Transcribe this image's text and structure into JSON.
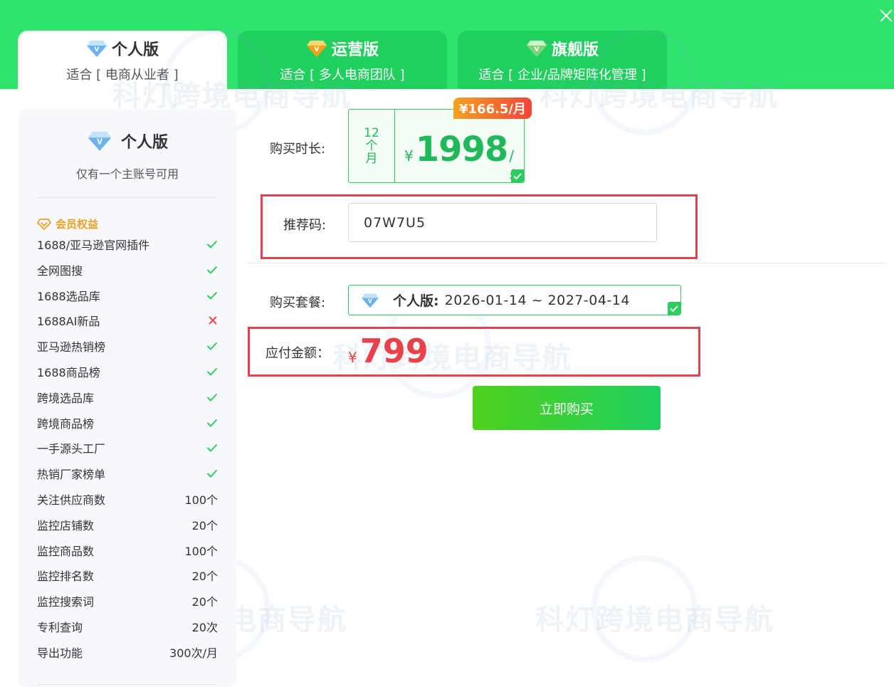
{
  "colors": {
    "header_green": "#2ee46c",
    "accent_green": "#1fb95a",
    "price_red": "#e8414a",
    "badge_orange": "#f7a01e",
    "benefits_orange": "#f0a020",
    "highlight_red": "#e2404c"
  },
  "watermark_text": "科灯跨境电商导航",
  "tabs": [
    {
      "title": "个人版",
      "subtitle": "适合 [ 电商从业者 ]",
      "icon": "diamond-blue-icon",
      "active": true
    },
    {
      "title": "运营版",
      "subtitle": "适合 [ 多人电商团队 ]",
      "icon": "diamond-gold-icon",
      "active": false
    },
    {
      "title": "旗舰版",
      "subtitle": "适合 [ 企业/品牌矩阵化管理 ]",
      "icon": "diamond-green-icon",
      "active": false
    }
  ],
  "left_panel": {
    "title": "个人版",
    "subtitle": "仅有一个主账号可用",
    "benefits_heading": "会员权益",
    "benefits": [
      {
        "label": "1688/亚马逊官网插件",
        "status": "check"
      },
      {
        "label": "全网图搜",
        "status": "check"
      },
      {
        "label": "1688选品库",
        "status": "check"
      },
      {
        "label": "1688AI新品",
        "status": "cross"
      },
      {
        "label": "亚马逊热销榜",
        "status": "check"
      },
      {
        "label": "1688商品榜",
        "status": "check"
      },
      {
        "label": "跨境选品库",
        "status": "check"
      },
      {
        "label": "跨境商品榜",
        "status": "check"
      },
      {
        "label": "一手源头工厂",
        "status": "check"
      },
      {
        "label": "热销厂家榜单",
        "status": "check"
      },
      {
        "label": "关注供应商数",
        "value": "100个"
      },
      {
        "label": "监控店铺数",
        "value": "20个"
      },
      {
        "label": "监控商品数",
        "value": "100个"
      },
      {
        "label": "监控排名数",
        "value": "20个"
      },
      {
        "label": "监控搜索词",
        "value": "20个"
      },
      {
        "label": "专利查询",
        "value": "20次"
      },
      {
        "label": "导出功能",
        "value": "300次/月"
      }
    ]
  },
  "form": {
    "duration_label": "购买时长:",
    "duration_option": {
      "months_chars": [
        "12",
        "个",
        "月"
      ],
      "currency": "¥",
      "price": "1998",
      "unit": "/年",
      "monthly_badge": "¥166.5/月",
      "selected": true
    },
    "referral_label": "推荐码:",
    "referral_value": "07W7U5",
    "plan_label": "购买套餐:",
    "plan_name": "个人版:",
    "plan_dates": "2026-01-14 ~ 2027-04-14",
    "amount_label": "应付金额：",
    "amount_currency": "¥",
    "amount_value": "799",
    "buy_button": "立即购买"
  }
}
